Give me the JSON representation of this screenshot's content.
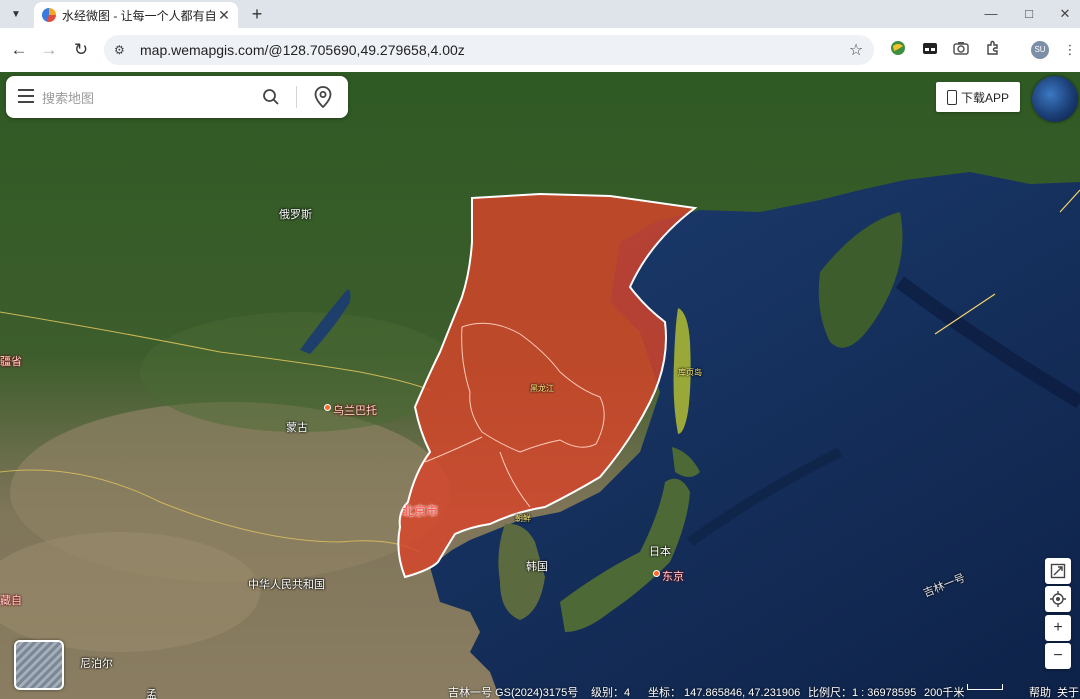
{
  "browser": {
    "tab_title": "水经微图 - 让每一个人都有自己",
    "url": "map.wemapgis.com/@128.705690,49.279658,4.00z",
    "avatar_initials": "SU"
  },
  "search": {
    "placeholder": "搜索地图"
  },
  "download_label": "下载APP",
  "map_labels": {
    "russia": "俄罗斯",
    "mongolia": "蒙古",
    "ulaanbaatar": "乌兰巴托",
    "china": "中华人民共和国",
    "korea": "韩国",
    "japan": "日本",
    "tokyo": "东京",
    "beijing": "北京市",
    "nepal": "尼泊尔",
    "west_edge_1": "疆省",
    "west_edge_2": "藏自",
    "bottom_edge": "孟",
    "heilongjiang_small": "黑龙江",
    "sakhalin_small": "库页岛",
    "coast_small": "朝鲜",
    "satellite_track": "吉林一号"
  },
  "status": {
    "source": "吉林一号 GS(2024)3175号",
    "level": "级别：4",
    "coords": "坐标：  147.865846, 47.231906",
    "scale": "比例尺：1 : 36978595",
    "scale_bar": "200千米",
    "help": "帮助",
    "about": "关于"
  },
  "colors": {
    "highlight_fill": "#d8442a",
    "highlight_stroke": "#ffffff"
  }
}
